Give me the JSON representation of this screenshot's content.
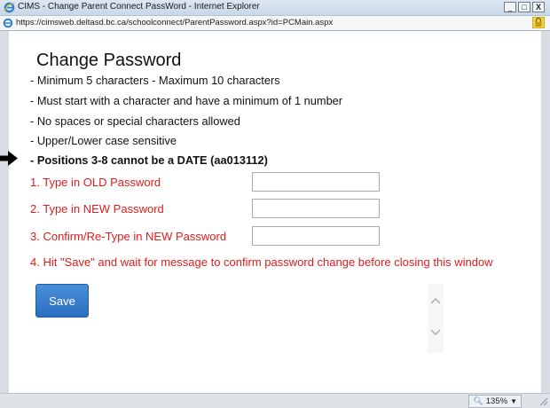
{
  "window": {
    "title": "CIMS - Change Parent Connect PassWord - Internet Explorer",
    "controls": {
      "minimize": "_",
      "maximize": "□",
      "close": "X"
    }
  },
  "address": {
    "url": "https://cimsweb.deltasd.bc.ca/schoolconnect/ParentPassword.aspx?id=PCMain.aspx"
  },
  "page": {
    "heading": "Change Password",
    "rules": [
      "- Minimum 5 characters - Maximum 10 characters",
      "- Must start with a character and have a minimum of 1 number",
      "- No spaces or special characters allowed",
      "- Upper/Lower case sensitive",
      "- Positions 3-8 cannot be a DATE (aa013112)"
    ],
    "fields": [
      {
        "label": "1. Type in OLD Password",
        "value": ""
      },
      {
        "label": "2. Type in NEW Password",
        "value": ""
      },
      {
        "label": "3. Confirm/Re-Type in NEW Password",
        "value": ""
      }
    ],
    "instruction": "4. Hit \"Save\" and wait for message to confirm password change before closing this window",
    "save_label": "Save"
  },
  "status": {
    "zoom": "135%"
  },
  "colors": {
    "label_red": "#e01c1c",
    "save_blue": "#2a6ebf"
  }
}
